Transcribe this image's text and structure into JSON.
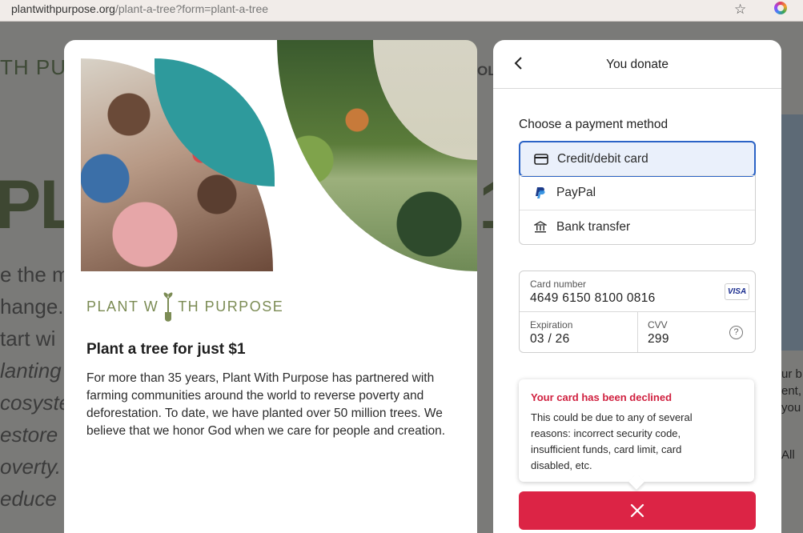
{
  "browser": {
    "url_domain": "plantwithpurpose.org",
    "url_path": "/plant-a-tree?form=plant-a-tree",
    "star_icon": "star-icon",
    "extension_icon": "colorful-extension-icon"
  },
  "background_page": {
    "logo_fragment": "TH PU",
    "nav_fragment": "OL",
    "headline_left": "PLA",
    "headline_right": "1",
    "lines": [
      "e the m",
      "hange.",
      "tart wi",
      "lanting",
      "cosyste",
      "estore",
      "overty.",
      "educe"
    ],
    "right_lines": [
      "ur b",
      "ent,",
      "you",
      "All"
    ]
  },
  "campaign": {
    "brand_left": "PLANT W",
    "brand_right": "TH PURPOSE",
    "title": "Plant a tree for just $1",
    "description": "For more than 35 years, Plant With Purpose has partnered with farming communities around the world to reverse poverty and deforestation. To date, we have planted over 50 million trees. We believe that we honor God when we care for people and creation."
  },
  "donate": {
    "header_title": "You donate",
    "payment_label": "Choose a payment method",
    "payment_methods": [
      {
        "label": "Credit/debit card",
        "icon": "credit-card-icon",
        "selected": true
      },
      {
        "label": "PayPal",
        "icon": "paypal-icon",
        "selected": false
      },
      {
        "label": "Bank transfer",
        "icon": "bank-icon",
        "selected": false
      }
    ],
    "card": {
      "number_label": "Card number",
      "number_value": "4649 6150 8100 0816",
      "brand": "VISA",
      "expiration_label": "Expiration",
      "expiration_value": "03 / 26",
      "cvv_label": "CVV",
      "cvv_value": "299",
      "cvv_help": "?"
    },
    "error": {
      "title": "Your card has been declined",
      "message": "This could be due to any of several reasons: incorrect security code, insufficient funds, card limit, card disabled, etc."
    },
    "colors": {
      "accent": "#2b63c6",
      "error": "#dc2445",
      "brand_green": "#7c8c55"
    }
  }
}
